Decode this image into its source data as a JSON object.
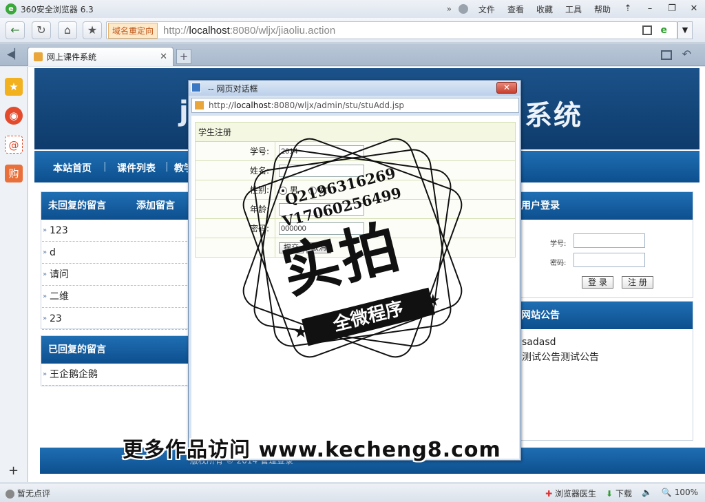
{
  "browser": {
    "title": "360安全浏览器 6.3",
    "menus": [
      "文件",
      "查看",
      "收藏",
      "工具",
      "帮助"
    ],
    "redirect_label": "域名重定向",
    "url_prefix": "http://",
    "url_host": "localhost",
    "url_rest": ":8080/wljx/jiaoliu.action",
    "tab_title": "网上课件系统"
  },
  "site": {
    "banner_left": "j",
    "banner_right": "系统",
    "nav": [
      "本站首页",
      "课件列表",
      "教学"
    ],
    "nav_sep": "|",
    "unreplied_title": "未回复的留言",
    "add_message": "添加留言",
    "unreplied_items": [
      "123",
      "d",
      "请问",
      "二维",
      "23"
    ],
    "replied_title": "已回复的留言",
    "replied_items": [
      "王企鹅企鹅"
    ],
    "login_title": "用户登录",
    "login_id_label": "学号:",
    "login_pw_label": "密码:",
    "login_button": "登 录",
    "register_button": "注 册",
    "notice_title": "网站公告",
    "notices": [
      "sadasd",
      "测试公告测试公告"
    ],
    "footer_text": "版权所有 © 2014 管理登录"
  },
  "dialog": {
    "title": "-- 网页对话框",
    "close_label": "✕",
    "url_prefix": "http://",
    "url_host": "localhost",
    "url_rest": ":8080/wljx/admin/stu/stuAdd.jsp",
    "form_title": "学生注册",
    "fields": {
      "id_label": "学号:",
      "id_value": "2014",
      "name_label": "姓名:",
      "name_value": "",
      "gender_label": "性别:",
      "gender_male": "男",
      "gender_female": "女",
      "gender_selected": "男",
      "age_label": "年龄:",
      "age_value": "",
      "pw_label": "密码:",
      "pw_value": "000000",
      "submit_label": "提交",
      "reset_label": "取消"
    }
  },
  "watermark": {
    "line1": "Q2196316269",
    "line2": "V17060256499",
    "big": "实拍",
    "ribbon": "全微程序"
  },
  "promo": "更多作品访问 www.kecheng8.com",
  "statusbar": {
    "left": "暂无点评",
    "doctor": "浏览器医生",
    "download": "下载",
    "zoom": "100%"
  }
}
